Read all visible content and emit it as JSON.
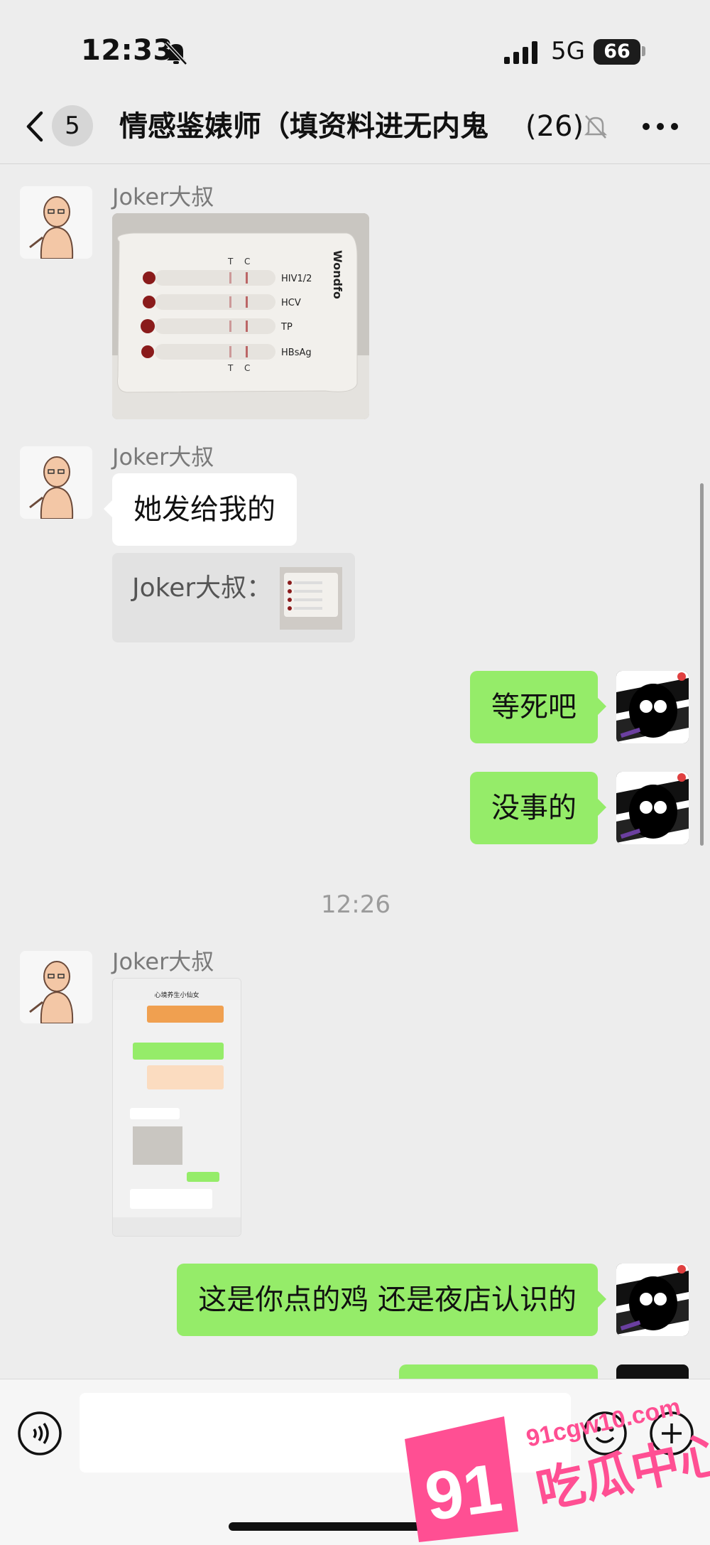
{
  "status_bar": {
    "time": "12:33",
    "network": "5G",
    "battery": "66"
  },
  "nav": {
    "unread_count": "5",
    "title": "情感鉴婊师（填资料进无内鬼",
    "member_count": "(26)"
  },
  "messages": [
    {
      "type": "image",
      "sender": "Joker大叔",
      "image_text": {
        "t": "T",
        "c": "C",
        "brand": "Wondfo",
        "labels": [
          "HIV1/2",
          "HCV",
          "TP",
          "HBsAg"
        ]
      }
    },
    {
      "type": "text",
      "sender": "Joker大叔",
      "text": "她发给我的",
      "quote": "Joker大叔："
    },
    {
      "type": "text_out",
      "text": "等死吧"
    },
    {
      "type": "text_out",
      "text": "没事的"
    },
    {
      "type": "time",
      "text": "12:26"
    },
    {
      "type": "image",
      "sender": "Joker大叔",
      "screenshot_title": "心境养生小仙女"
    },
    {
      "type": "text_out",
      "text": "这是你点的鸡 还是夜店认识的"
    }
  ],
  "watermark": {
    "number": "91",
    "site": "91cgw10.com",
    "name": "吃瓜中心"
  },
  "colors": {
    "outgoing_bubble": "#95ec69",
    "background": "#ededed",
    "watermark": "#ff4f93"
  }
}
